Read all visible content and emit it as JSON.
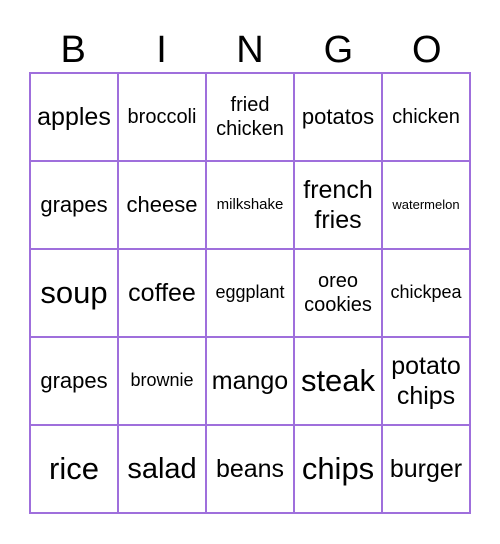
{
  "header": [
    "B",
    "I",
    "N",
    "G",
    "O"
  ],
  "border_color": "#9f6fdc",
  "cells": [
    [
      "apples",
      "broccoli",
      "fried chicken",
      "potatos",
      "chicken"
    ],
    [
      "grapes",
      "cheese",
      "milkshake",
      "french fries",
      "watermelon"
    ],
    [
      "soup",
      "coffee",
      "eggplant",
      "oreo cookies",
      "chickpea"
    ],
    [
      "grapes",
      "brownie",
      "mango",
      "steak",
      "potato chips"
    ],
    [
      "rice",
      "salad",
      "beans",
      "chips",
      "burger"
    ]
  ]
}
